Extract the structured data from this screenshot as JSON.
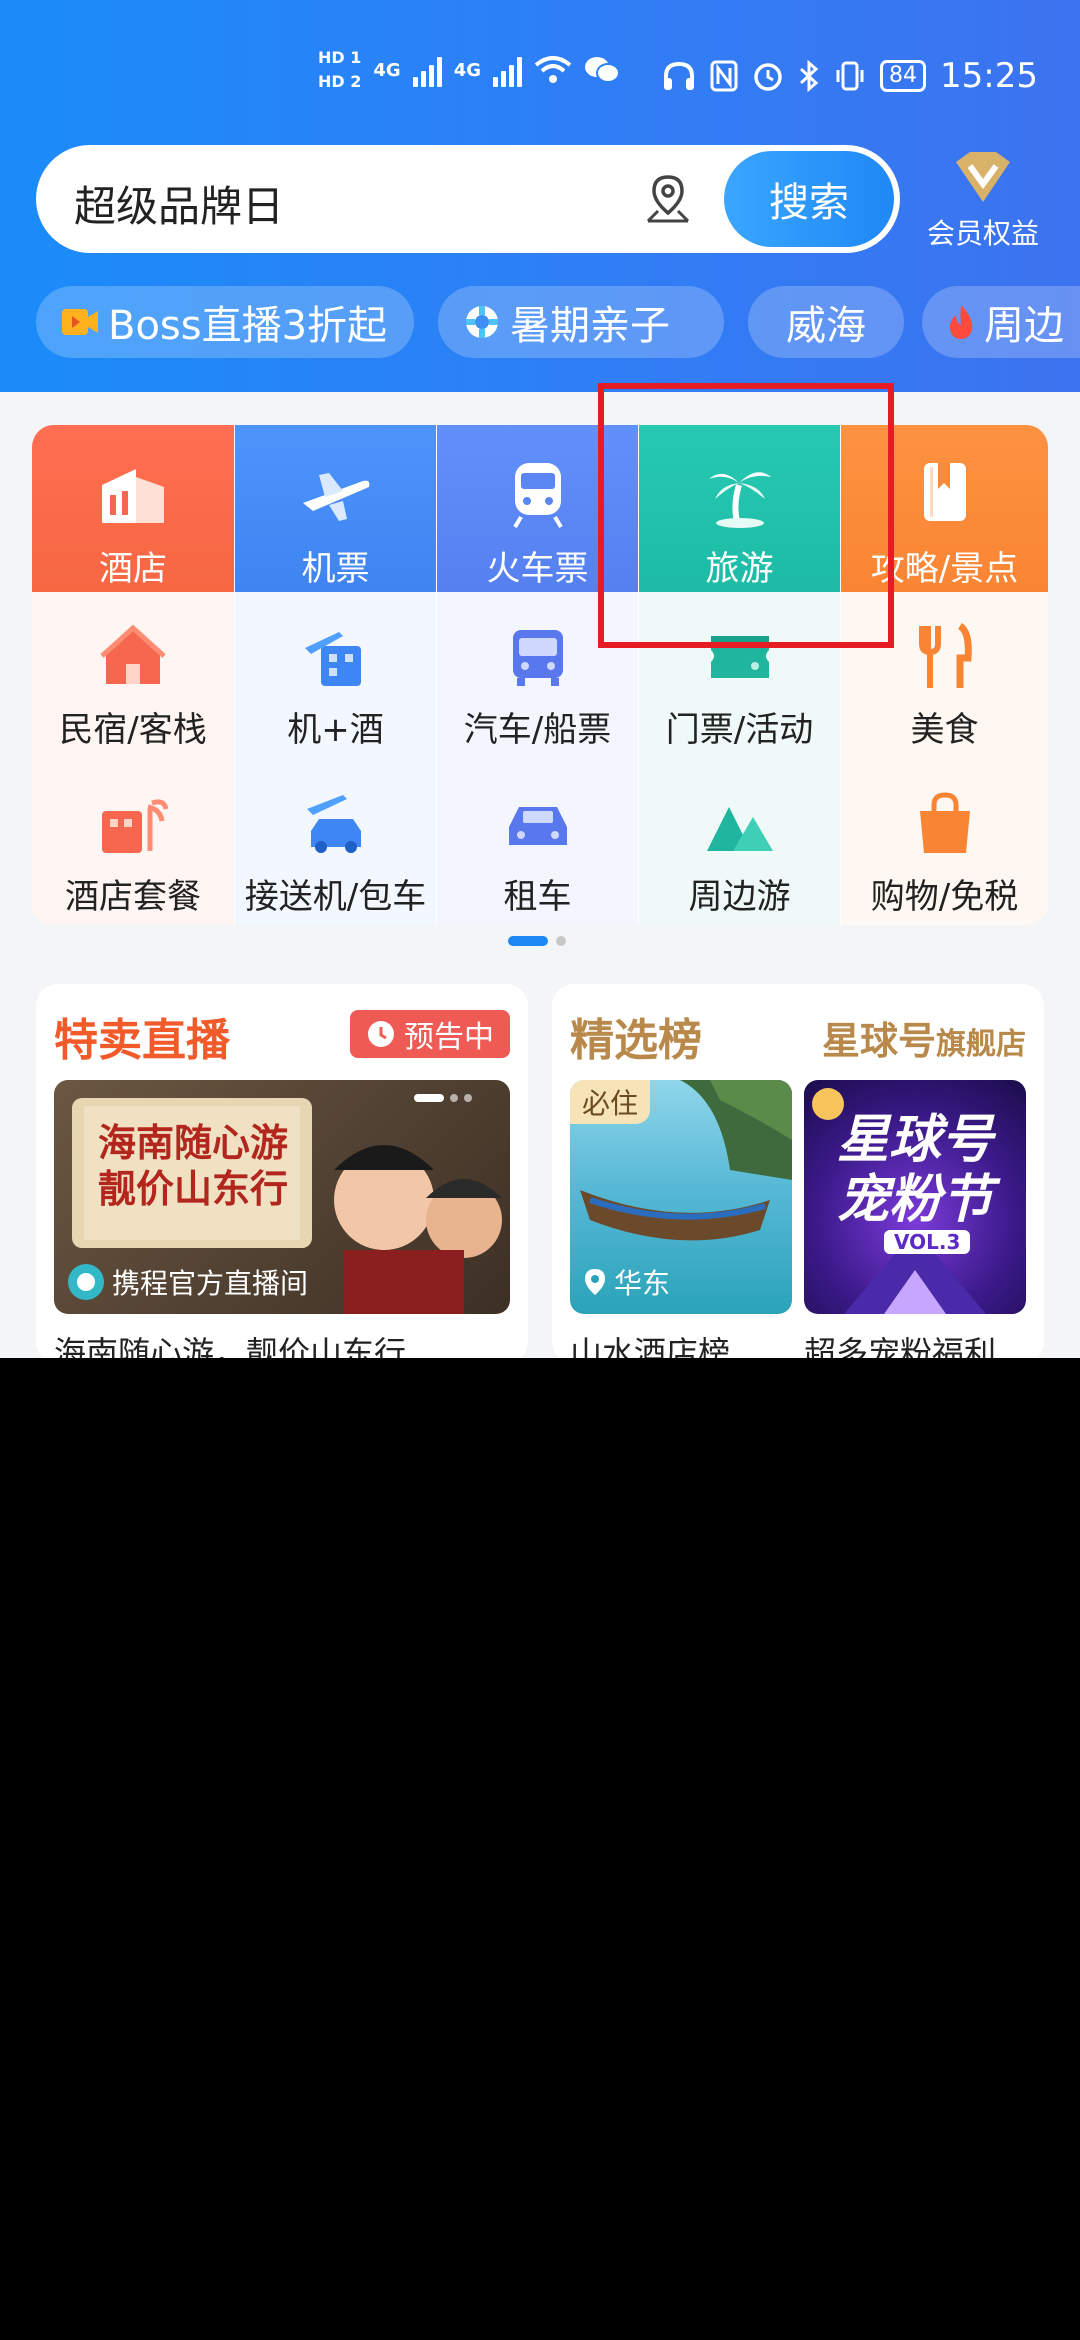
{
  "status_bar": {
    "hd1": "HD 1",
    "hd2": "HD 2",
    "net1": "4G",
    "net2": "4G",
    "battery": "84",
    "time": "15:25"
  },
  "search": {
    "text": "超级品牌日",
    "button": "搜索"
  },
  "vip": {
    "label": "会员权益"
  },
  "chips": [
    "Boss直播3折起",
    "暑期亲子",
    "威海",
    "周边"
  ],
  "grid": {
    "top": [
      {
        "label": "酒店",
        "icon": "hotel-icon",
        "color": "#f5684f"
      },
      {
        "label": "机票",
        "icon": "plane-icon",
        "color": "#4a8cf4"
      },
      {
        "label": "火车票",
        "icon": "train-icon",
        "color": "#5a86f2"
      },
      {
        "label": "旅游",
        "icon": "palm-tree-icon",
        "color": "#22c2ad"
      },
      {
        "label": "攻略/景点",
        "icon": "guide-book-icon",
        "color": "#fb8a3a"
      }
    ],
    "row2": [
      {
        "label": "民宿/客栈",
        "icon": "homestay-icon"
      },
      {
        "label": "机+酒",
        "icon": "flight-hotel-icon"
      },
      {
        "label": "汽车/船票",
        "icon": "bus-icon"
      },
      {
        "label": "门票/活动",
        "icon": "ticket-icon"
      },
      {
        "label": "美食",
        "icon": "food-icon"
      }
    ],
    "row3": [
      {
        "label": "酒店套餐",
        "icon": "hotel-package-icon"
      },
      {
        "label": "接送机/包车",
        "icon": "transfer-car-icon"
      },
      {
        "label": "租车",
        "icon": "rental-car-icon"
      },
      {
        "label": "周边游",
        "icon": "mountain-icon"
      },
      {
        "label": "购物/免税",
        "icon": "shopping-bag-icon"
      }
    ]
  },
  "card_live": {
    "title": "特卖直播",
    "badge": "预告中",
    "poster_title1": "海南随心游",
    "poster_title2": "靓价山东行",
    "channel": "携程官方直播间",
    "caption": "海南随心游，靓价山东行"
  },
  "card_rank": {
    "title": "精选榜",
    "brand": "星球号",
    "brand_suffix": "旗舰店",
    "item1_tag": "必住",
    "item1_location": "华东",
    "item1_caption": "山水酒店榜",
    "item2_title1": "星球号",
    "item2_title2": "宠粉节",
    "item2_vol": "VOL.3",
    "item2_caption": "超多宠粉福利"
  }
}
